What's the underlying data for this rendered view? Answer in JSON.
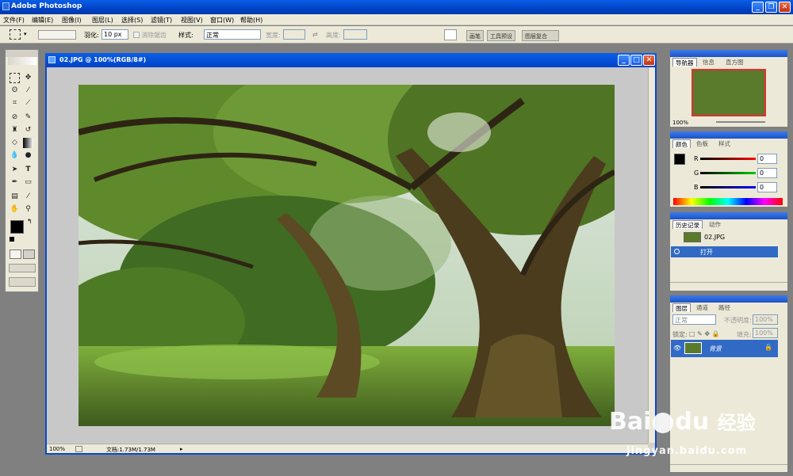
{
  "app": {
    "title": "Adobe Photoshop"
  },
  "menu": [
    "文件(F)",
    "编辑(E)",
    "图像(I)",
    "图层(L)",
    "选择(S)",
    "滤镜(T)",
    "视图(V)",
    "窗口(W)",
    "帮助(H)"
  ],
  "options": {
    "feather_label": "羽化:",
    "feather_value": "10 px",
    "antialias_label": "消除锯齿",
    "style_label": "样式:",
    "style_value": "正常",
    "width_label": "宽度:",
    "height_label": "高度:",
    "well_tabs": [
      "画笔",
      "工具预设",
      "图层复合"
    ]
  },
  "document": {
    "title": "02.JPG @ 100%(RGB/8#)",
    "zoom": "100%",
    "doc_info": "文档:1.73M/1.73M"
  },
  "navigator": {
    "tabs": [
      "导航器",
      "信息",
      "直方图"
    ],
    "zoom": "100%"
  },
  "color": {
    "tabs": [
      "颜色",
      "色板",
      "样式"
    ],
    "channels": [
      {
        "label": "R",
        "value": "0"
      },
      {
        "label": "G",
        "value": "0"
      },
      {
        "label": "B",
        "value": "0"
      }
    ]
  },
  "history": {
    "tabs": [
      "历史记录",
      "动作"
    ],
    "snapshot": "02.JPG",
    "items": [
      "打开"
    ]
  },
  "layers": {
    "tabs": [
      "图层",
      "通道",
      "路径"
    ],
    "blend_mode": "正常",
    "opacity_label": "不透明度:",
    "opacity_value": "100%",
    "lock_label": "锁定:",
    "fill_label": "填充:",
    "fill_value": "100%",
    "items": [
      "背景"
    ]
  },
  "watermark": {
    "brand": "Bai",
    "brand2": "du",
    "cn": "经验",
    "url": "jingyan.baidu.com"
  }
}
